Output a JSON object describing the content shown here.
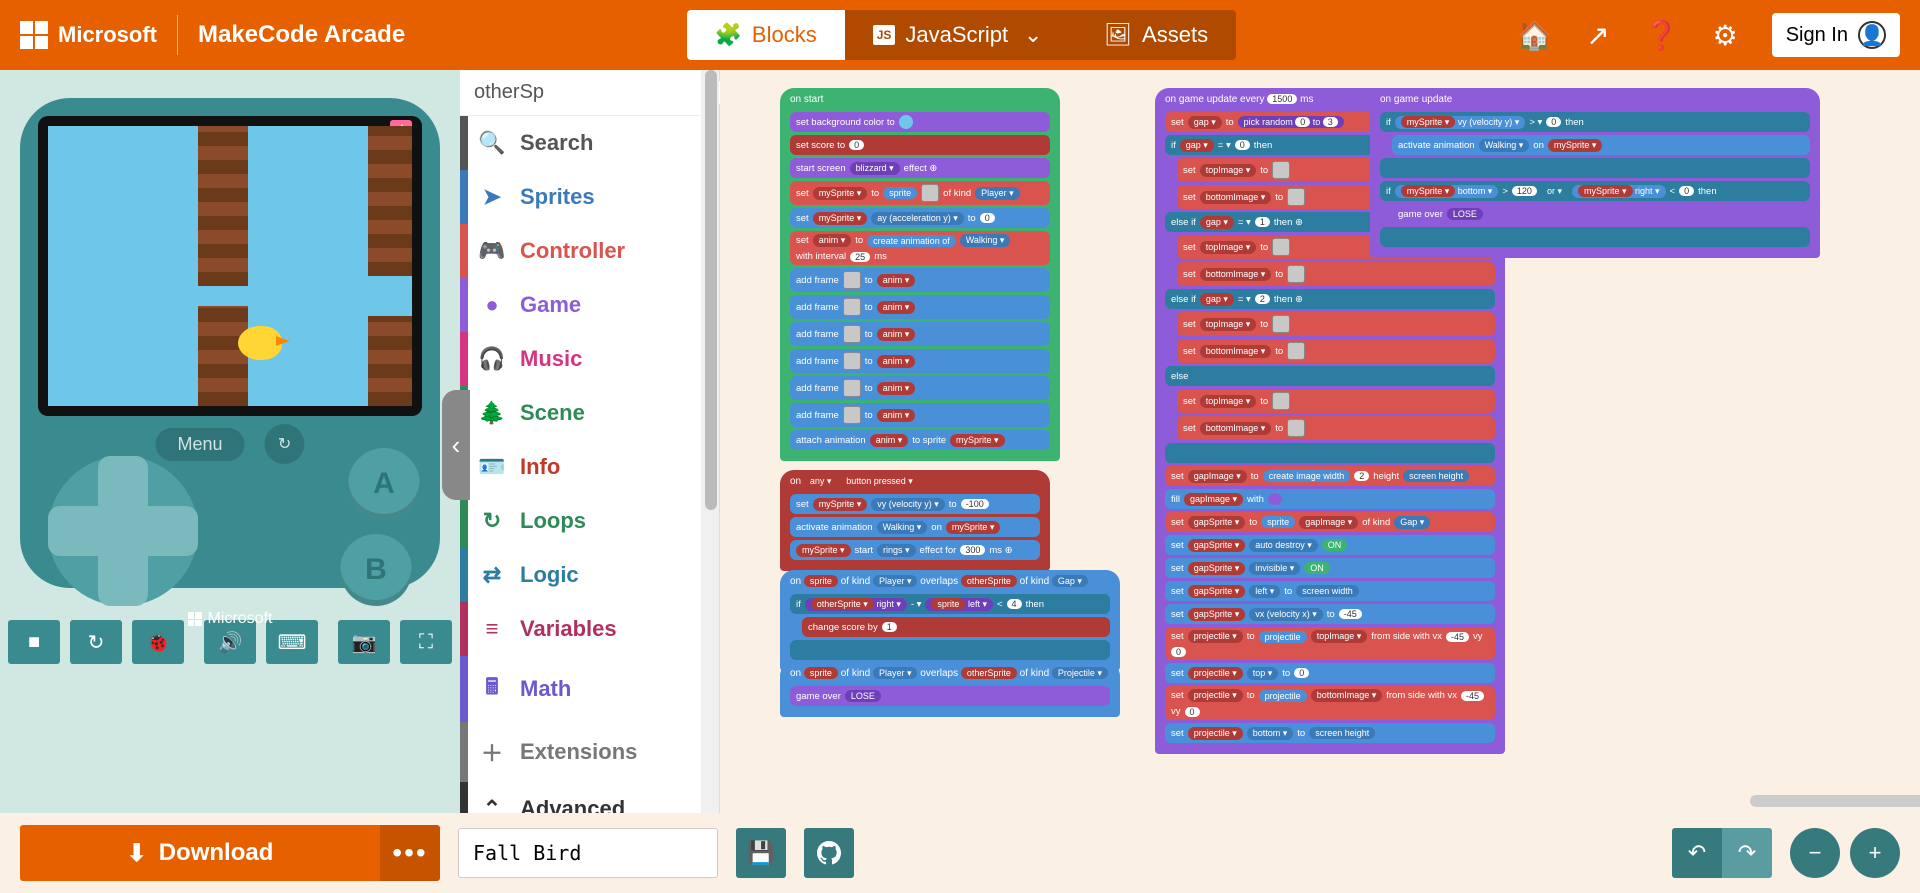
{
  "header": {
    "brand": "Microsoft",
    "product": "MakeCode Arcade",
    "tabs": {
      "blocks": "Blocks",
      "javascript": "JavaScript",
      "assets": "Assets"
    },
    "signin": "Sign In"
  },
  "simulator": {
    "menu": "Menu",
    "a": "A",
    "b": "B",
    "ms_footer": "Microsoft"
  },
  "toolbox": {
    "search_value": "otherSp",
    "categories": [
      {
        "label": "Search",
        "color": "#555555",
        "icon": "🔍"
      },
      {
        "label": "Sprites",
        "color": "#3a7ab8",
        "icon": "➤"
      },
      {
        "label": "Controller",
        "color": "#d9534f",
        "icon": "🎮"
      },
      {
        "label": "Game",
        "color": "#8e5cd9",
        "icon": "●"
      },
      {
        "label": "Music",
        "color": "#d63384",
        "icon": "🎧"
      },
      {
        "label": "Scene",
        "color": "#2e8b57",
        "icon": "🌲"
      },
      {
        "label": "Info",
        "color": "#c0392b",
        "icon": "🪪"
      },
      {
        "label": "Loops",
        "color": "#2e8b57",
        "icon": "↻"
      },
      {
        "label": "Logic",
        "color": "#2c7da0",
        "icon": "⇄"
      },
      {
        "label": "Variables",
        "color": "#b03060",
        "icon": "≡"
      },
      {
        "label": "Math",
        "color": "#6a5acd",
        "icon": "🖩"
      },
      {
        "label": "Extensions",
        "color": "#777777",
        "icon": "＋"
      },
      {
        "label": "Advanced",
        "color": "#333333",
        "icon": "⌃"
      }
    ]
  },
  "blocks": {
    "onstart": {
      "hat": "on start",
      "setbg": "set background color to",
      "score": "set score to",
      "score_v": "0",
      "screen": [
        "start screen",
        "blizzard ▾",
        "effect ⊕"
      ],
      "mysprite": [
        "set",
        "mySprite ▾",
        "to",
        "sprite",
        "of kind",
        "Player ▾"
      ],
      "accel": [
        "set",
        "mySprite ▾",
        "ay (acceleration y) ▾",
        "to",
        "0"
      ],
      "anim": [
        "set",
        "anim ▾",
        "to",
        "create animation of",
        "Walking ▾",
        "with interval",
        "25",
        "ms"
      ],
      "addframe": "add frame",
      "to": "to",
      "animv": "anim ▾",
      "attach": [
        "attach animation",
        "anim ▾",
        "to sprite",
        "mySprite ▾"
      ]
    },
    "onbutton": {
      "hat": [
        "on",
        "any ▾",
        "button pressed ▾"
      ],
      "vy": [
        "set",
        "mySprite ▾",
        "vy (velocity y) ▾",
        "to",
        "-100"
      ],
      "act": [
        "activate animation",
        "Walking ▾",
        "on",
        "mySprite ▾"
      ],
      "rings": [
        "mySprite ▾",
        "start",
        "rings ▾",
        "effect for",
        "300",
        "ms ⊕"
      ]
    },
    "overlap1": {
      "hat": [
        "on",
        "sprite",
        "of kind",
        "Player ▾",
        "overlaps",
        "otherSprite",
        "of kind",
        "Gap ▾"
      ],
      "if": [
        "if",
        "otherSprite ▾",
        "right ▾",
        "- ▾",
        "sprite",
        "left ▾",
        "<",
        "4",
        "then"
      ],
      "chg": [
        "change score by",
        "1"
      ]
    },
    "overlap2": {
      "hat": [
        "on",
        "sprite",
        "of kind",
        "Player ▾",
        "overlaps",
        "otherSprite",
        "of kind",
        "Projectile ▾"
      ],
      "lose": [
        "game over",
        "LOSE"
      ]
    },
    "onupdateevery": {
      "hat": [
        "on game update every",
        "1500",
        "ms"
      ],
      "gap": [
        "set",
        "gap ▾",
        "to",
        "pick random",
        "0",
        "to",
        "3"
      ],
      "if0": [
        "if",
        "gap ▾",
        "= ▾",
        "0",
        "then"
      ],
      "settop": [
        "set",
        "topImage ▾",
        "to"
      ],
      "setbot": [
        "set",
        "bottomImage ▾",
        "to"
      ],
      "elif1": [
        "else if",
        "gap ▾",
        "= ▾",
        "1",
        "then ⊕"
      ],
      "elif2": [
        "else if",
        "gap ▾",
        "= ▾",
        "2",
        "then ⊕"
      ],
      "else": "else",
      "gapimg": [
        "set",
        "gapImage ▾",
        "to",
        "create image width",
        "2",
        "height",
        "screen height"
      ],
      "fill": [
        "fill",
        "gapImage ▾",
        "with"
      ],
      "gapsprite": [
        "set",
        "gapSprite ▾",
        "to",
        "sprite",
        "gapImage ▾",
        "of kind",
        "Gap ▾"
      ],
      "auto": [
        "set",
        "gapSprite ▾",
        "auto destroy ▾",
        "ON"
      ],
      "invis": [
        "set",
        "gapSprite ▾",
        "invisible ▾",
        "ON"
      ],
      "left": [
        "set",
        "gapSprite ▾",
        "left ▾",
        "to",
        "screen width"
      ],
      "vx": [
        "set",
        "gapSprite ▾",
        "vx (velocity x) ▾",
        "to",
        "-45"
      ],
      "proj1": [
        "set",
        "projectile ▾",
        "to",
        "projectile",
        "topImage ▾",
        "from side with vx",
        "-45",
        "vy",
        "0"
      ],
      "projtop": [
        "set",
        "projectile ▾",
        "top ▾",
        "to",
        "0"
      ],
      "proj2": [
        "set",
        "projectile ▾",
        "to",
        "projectile",
        "bottomImage ▾",
        "from side with vx",
        "-45",
        "vy",
        "0"
      ],
      "projbot": [
        "set",
        "projectile ▾",
        "bottom ▾",
        "to",
        "screen height"
      ]
    },
    "onupdate": {
      "hat": "on game update",
      "if": [
        "if",
        "mySprite ▾",
        "vy (velocity y) ▾",
        "> ▾",
        "0",
        "then"
      ],
      "act": [
        "activate animation",
        "Walking ▾",
        "on",
        "mySprite ▾"
      ],
      "if2": [
        "if",
        "mySprite ▾",
        "bottom ▾",
        ">",
        "120",
        "or ▾",
        "mySprite ▾",
        "right ▾",
        "<",
        "0",
        "then"
      ],
      "lose": [
        "game over",
        "LOSE"
      ]
    }
  },
  "footer": {
    "download": "Download",
    "project_name": "Fall Bird"
  }
}
